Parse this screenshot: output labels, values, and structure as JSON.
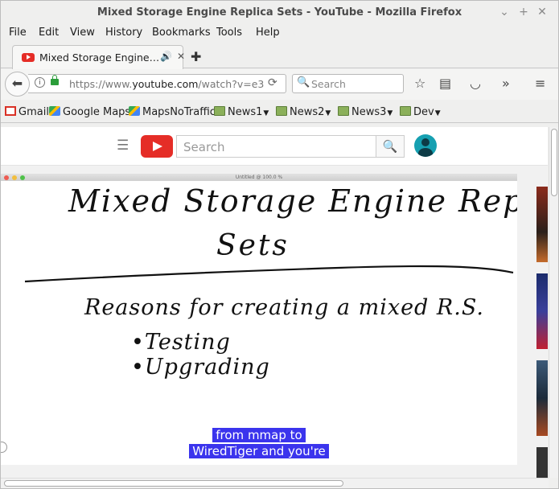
{
  "window": {
    "title": "Mixed Storage Engine Replica Sets - YouTube - Mozilla Firefox",
    "controls": [
      "⌄",
      "+",
      "✕"
    ]
  },
  "menu": [
    "File",
    "Edit",
    "View",
    "History",
    "Bookmarks",
    "Tools",
    "Help"
  ],
  "tab": {
    "label": "Mixed Storage Engine…",
    "audio_icon": "🔊",
    "close": "✕",
    "new_tab": "✚"
  },
  "nav": {
    "url_prefix": "https://www.",
    "url_host": "youtube.com",
    "url_path": "/watch?v=e3",
    "search_placeholder": "Search"
  },
  "bookmarks": [
    "Gmail",
    "Google Maps",
    "MapsNoTraffic",
    "News1",
    "News2",
    "News3",
    "Dev"
  ],
  "youtube": {
    "search_placeholder": "Search"
  },
  "video": {
    "window_caption": "Untitled @ 100.0 %",
    "handwriting": {
      "title_line1": "Mixed Storage Engine Replica",
      "title_line2": "Sets",
      "subtitle": "Reasons for creating a mixed R.S.",
      "bullet1": "•Testing",
      "bullet2": "•Upgrading"
    },
    "captions": [
      "from mmap to",
      "WiredTiger and you're"
    ]
  },
  "colors": {
    "youtube_red": "#e52d27",
    "caption_bg": "#3b34ed",
    "avatar": "#16a0b1",
    "lock_green": "#2b9d3a"
  }
}
